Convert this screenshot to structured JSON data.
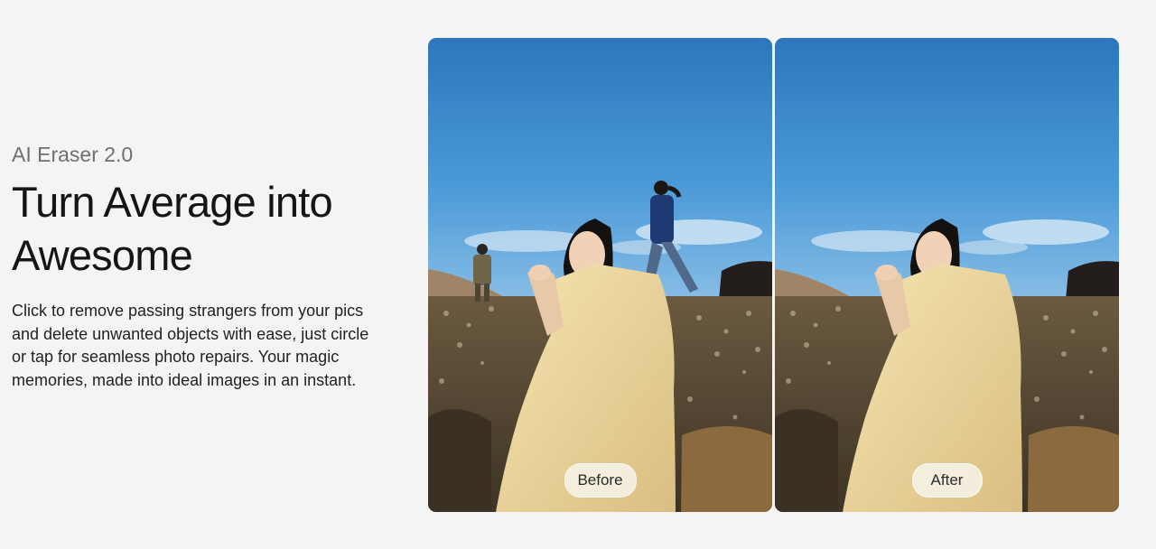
{
  "section": {
    "eyebrow": "AI Eraser 2.0",
    "headline_line1": "Turn Average into",
    "headline_line2": "Awesome",
    "description": "Click to remove passing strangers from your pics and delete unwanted objects with ease, just circle or tap for seamless photo repairs. Your magic memories, made into ideal images in an instant."
  },
  "comparison": {
    "before_label": "Before",
    "after_label": "After"
  }
}
